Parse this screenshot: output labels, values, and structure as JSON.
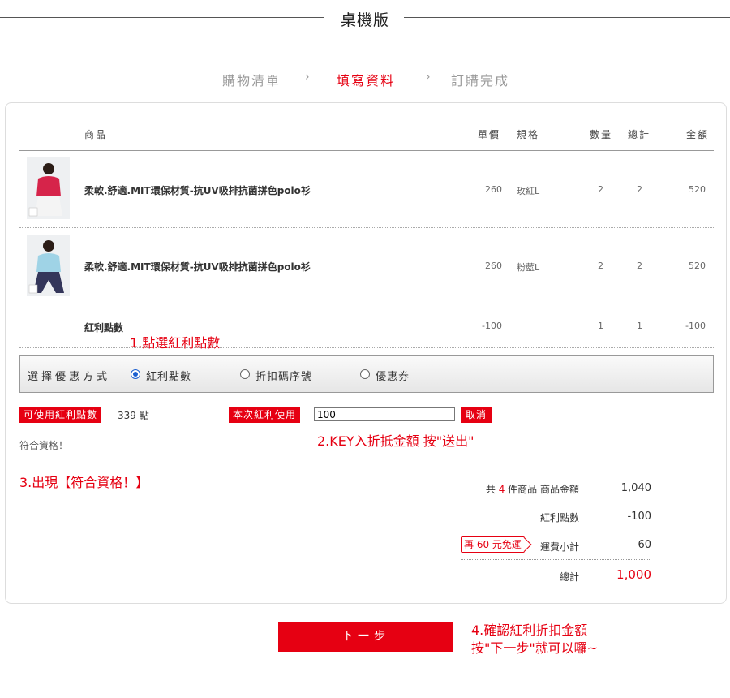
{
  "title": "桌機版",
  "steps": [
    {
      "label": "購物清單",
      "active": false
    },
    {
      "label": "填寫資料",
      "active": true
    },
    {
      "label": "訂購完成",
      "active": false
    }
  ],
  "step_separator": "›",
  "table": {
    "headers": {
      "product": "商品",
      "price": "單價",
      "spec": "規格",
      "qty": "數量",
      "total": "總計",
      "amount": "金額"
    },
    "rows": [
      {
        "name": "柔軟.舒適.MIT環保材質-抗UV吸排抗菌拼色polo衫",
        "price": "260",
        "spec": "玫紅L",
        "qty": "2",
        "total": "2",
        "amount": "520"
      },
      {
        "name": "柔軟.舒適.MIT環保材質-抗UV吸排抗菌拼色polo衫",
        "price": "260",
        "spec": "粉藍L",
        "qty": "2",
        "total": "2",
        "amount": "520"
      },
      {
        "name": "紅利點數",
        "price": "-100",
        "spec": "",
        "qty": "1",
        "total": "1",
        "amount": "-100"
      }
    ]
  },
  "annotations": {
    "a1": "1.點選紅利點數",
    "a2": "2.KEY入折抵金額  按\"送出\"",
    "a3": "3.出現【符合資格！】",
    "a4_line1": "4.確認紅利折扣金額",
    "a4_line2": "按\"下一步\"就可以囉~"
  },
  "discount": {
    "label": "選擇優惠方式",
    "options": [
      {
        "label": "紅利點數",
        "selected": true
      },
      {
        "label": "折扣碼序號",
        "selected": false
      },
      {
        "label": "優惠券",
        "selected": false
      }
    ]
  },
  "points": {
    "available_label": "可使用紅利點數",
    "available_value": "339 點",
    "use_label": "本次紅利使用",
    "input_value": "100",
    "cancel_label": "取消",
    "status": "符合資格！"
  },
  "summary": {
    "count_prefix": "共",
    "count": "4",
    "count_suffix": "件商品 商品金額",
    "subtotal": "1,040",
    "bonus_label": "紅利點數",
    "bonus_value": "-100",
    "ship_badge": "再 60 元免運",
    "ship_label": "運費小計",
    "ship_value": "60",
    "total_label": "總計",
    "total_value": "1,000"
  },
  "next_button": "下一步",
  "colors": {
    "accent": "#e60012",
    "muted": "#999999"
  }
}
